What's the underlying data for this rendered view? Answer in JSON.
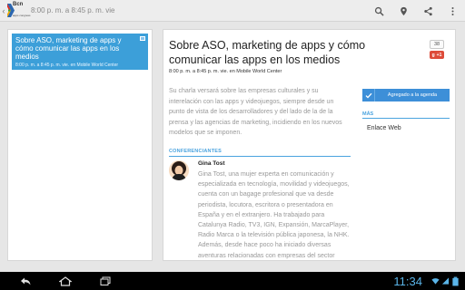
{
  "actionbar": {
    "logo_text": "Bcn",
    "logo_sub": "apps congress",
    "title": "8:00 p. m. a 8:45 p. m. vie",
    "actions": [
      "search-icon",
      "location-icon",
      "share-icon",
      "overflow-icon"
    ]
  },
  "list": {
    "items": [
      {
        "title": "Sobre ASO, marketing de apps y cómo comunicar las apps en los medios",
        "subtitle": "8:00 p. m. a 8:45 p. m. vie. en Mobile World Center"
      }
    ]
  },
  "detail": {
    "title": "Sobre ASO, marketing de apps y cómo comunicar las apps en los medios",
    "meta": "8:00 p. m. a 8:45 p. m. vie. en Mobile World Center",
    "share_count": "38",
    "gplus_label": "+1",
    "description": "Su charla versará sobre las empresas culturales y su interelación con las apps y videojuegos, siempre desde un punto de vista de los desarrolladores y del lado de la de la prensa y las agencias de marketing, incidiendo en los nuevos modelos que se imponen.",
    "speakers_header": "CONFERENCIANTES",
    "speaker": {
      "name": "Gina Tost",
      "bio": "Gina Tost, una mujer experta en comunicación y especializada en tecnología, movilidad y videojuegos, cuenta con un bagage profesional que va desde periodista, locutora, escritora o presentadora en España y en el extranjero. Ha trabajado para Catalunya Radio, TV3, IGN, Expansión, MarcaPlayer, Radio Marca o la televisión pública japonesa, la NHK. Además, desde hace poco ha iniciado diversas aventuras relacionadas con empresas del sector"
    },
    "agenda_button": "Agregado a la agenda",
    "more_header": "MÁS",
    "link_label": "Enlace Web"
  },
  "system": {
    "time": "11:34",
    "nav": [
      "back-icon",
      "home-icon",
      "recents-icon"
    ]
  },
  "colors": {
    "accent": "#3c9fd9",
    "section": "#4aa3df",
    "clock": "#5ab4e8",
    "gplus": "#dd4b39"
  }
}
